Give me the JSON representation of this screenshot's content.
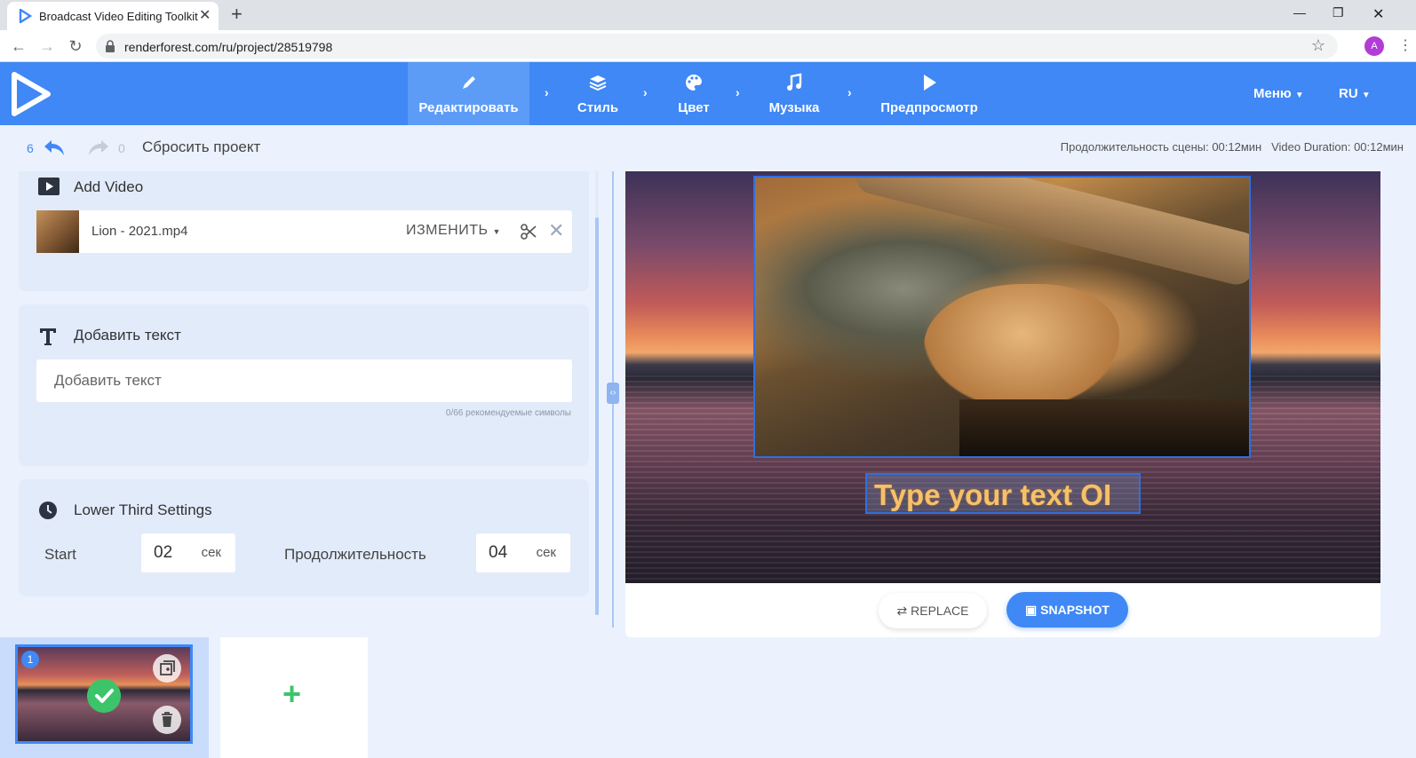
{
  "browser": {
    "tab_title": "Broadcast Video Editing Toolkit",
    "url": "renderforest.com/ru/project/28519798",
    "profile_initial": "A"
  },
  "header": {
    "steps": [
      {
        "label": "Редактировать",
        "icon": "pencil-icon",
        "active": true
      },
      {
        "label": "Стиль",
        "icon": "layers-icon",
        "active": false
      },
      {
        "label": "Цвет",
        "icon": "palette-icon",
        "active": false
      },
      {
        "label": "Музыка",
        "icon": "music-note-icon",
        "active": false
      },
      {
        "label": "Предпросмотр",
        "icon": "play-icon",
        "active": false
      }
    ],
    "menu_label": "Меню",
    "language_label": "RU"
  },
  "toolbar": {
    "undo_count": "6",
    "redo_count": "0",
    "reset_label": "Сбросить проект",
    "scene_duration": "Продолжительность сцены: 00:12мин",
    "video_duration": "Video Duration: 00:12мин"
  },
  "add_video": {
    "title": "Add Video",
    "file_name": "Lion - 2021.mp4",
    "change_label": "ИЗМЕНИТЬ"
  },
  "add_text": {
    "title": "Добавить текст",
    "placeholder": "Добавить текст",
    "char_hint": "0/66 рекомендуемые символы"
  },
  "lower_third": {
    "title": "Lower Third Settings",
    "start_label": "Start",
    "start_value": "02",
    "start_unit": "сек",
    "duration_label": "Продолжительность",
    "duration_value": "04",
    "duration_unit": "сек"
  },
  "preview": {
    "overlay_text": "Type your text OI",
    "replace_label": "REPLACE",
    "snapshot_label": "SNAPSHOT"
  },
  "timeline": {
    "scene_number": "1"
  },
  "colors": {
    "accent": "#3f88f5",
    "success": "#3cc46a",
    "panel_bg": "#ebf2fd",
    "card_bg": "#e2ebfa"
  }
}
